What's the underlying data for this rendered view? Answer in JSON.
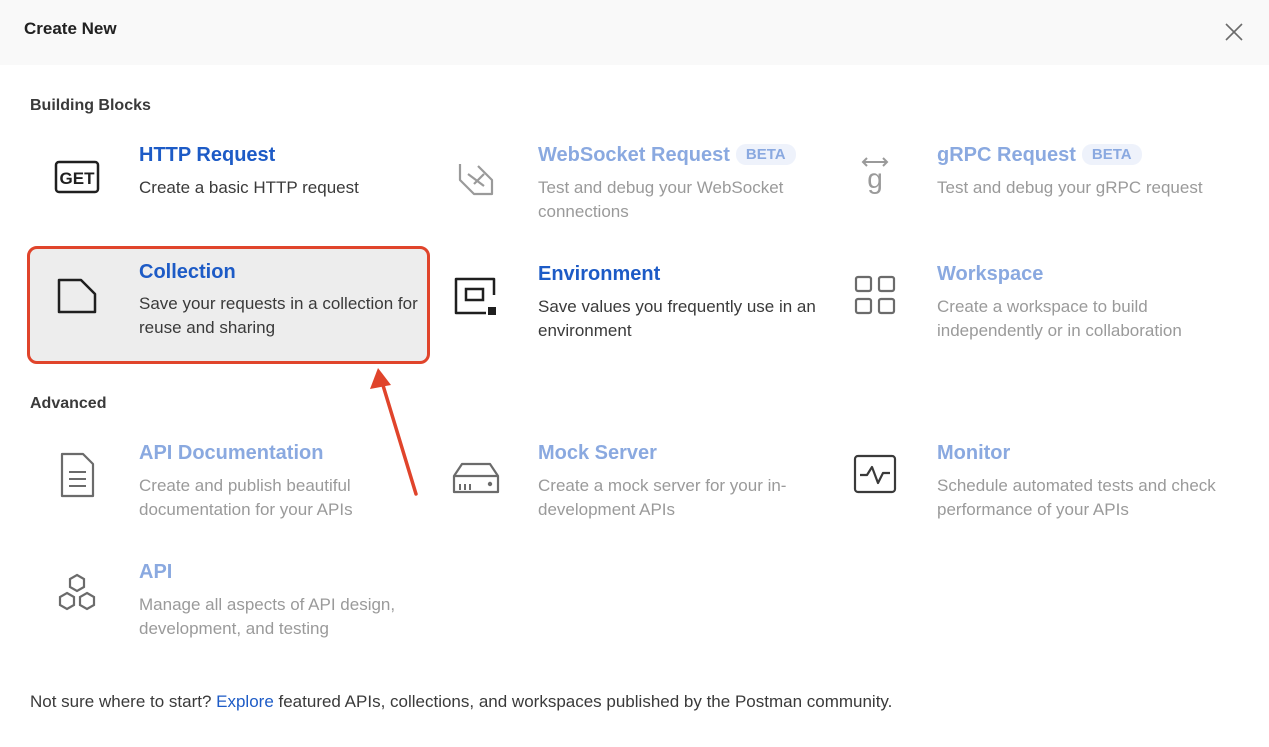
{
  "header": {
    "title": "Create New",
    "close_icon": "close-icon"
  },
  "sections": {
    "building_blocks": "Building Blocks",
    "advanced": "Advanced"
  },
  "items": {
    "http": {
      "title": "HTTP Request",
      "desc": "Create a basic HTTP request",
      "icon": "get-icon",
      "icon_text": "GET"
    },
    "websocket": {
      "title": "WebSocket Request",
      "badge": "BETA",
      "desc": "Test and debug your WebSocket connections",
      "icon": "websocket-icon"
    },
    "grpc": {
      "title": "gRPC Request",
      "badge": "BETA",
      "desc": "Test and debug your gRPC request",
      "icon": "grpc-icon"
    },
    "collection": {
      "title": "Collection",
      "desc": "Save your requests in a collection for reuse and sharing",
      "icon": "collection-icon"
    },
    "environment": {
      "title": "Environment",
      "desc": "Save values you frequently use in an environment",
      "icon": "environment-icon"
    },
    "workspace": {
      "title": "Workspace",
      "desc": "Create a workspace to build independently or in collaboration",
      "icon": "workspace-icon"
    },
    "api_documentation": {
      "title": "API Documentation",
      "desc": "Create and publish beautiful documentation for your APIs",
      "icon": "document-icon"
    },
    "mock_server": {
      "title": "Mock Server",
      "desc": "Create a mock server for your in-development APIs",
      "icon": "server-icon"
    },
    "monitor": {
      "title": "Monitor",
      "desc": "Schedule automated tests and check performance of your APIs",
      "icon": "monitor-icon"
    },
    "api": {
      "title": "API",
      "desc": "Manage all aspects of API design, development, and testing",
      "icon": "hexagons-icon"
    }
  },
  "footer": {
    "prefix": "Not sure where to start? ",
    "link": "Explore",
    "suffix": " featured APIs, collections, and workspaces published by the Postman community."
  },
  "colors": {
    "link": "#1d5bc6",
    "muted_link": "#8aa9e0",
    "highlight_border": "#e0442b",
    "annotation_arrow": "#e0442b"
  }
}
